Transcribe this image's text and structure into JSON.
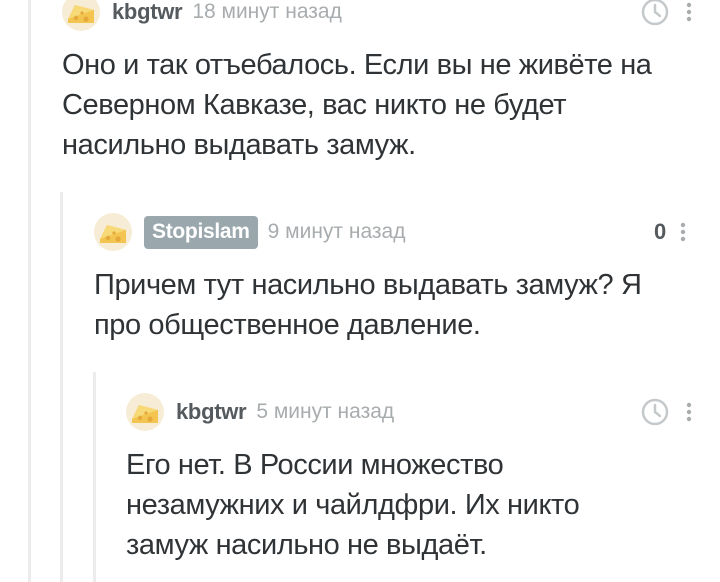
{
  "comments": [
    {
      "username": "kbgtwr",
      "timestamp": "18 минут назад",
      "lines": [
        "Оно и так отъебалось. Если вы не живёте на",
        "Северном Кавказе, вас никто не будет",
        "насильно выдавать замуж."
      ]
    },
    {
      "username": "Stopislam",
      "timestamp": "9 минут назад",
      "rating": "0",
      "lines": [
        "Причем тут насильно выдавать замуж? Я",
        "про общественное давление."
      ]
    },
    {
      "username": "kbgtwr",
      "timestamp": "5 минут назад",
      "lines": [
        "Его нет. В России множество",
        "незамужних и чайлдфри. Их никто",
        "замуж насильно не выдаёт."
      ]
    }
  ],
  "colors": {
    "text": "#2f3336",
    "username": "#555a5e",
    "timestamp": "#a8acae",
    "badge": "#9aa8ae",
    "thread_line": "#ececec",
    "icon": "#c5c9cb"
  },
  "icons": {
    "avatar": "cheese-avatar-icon",
    "save": "clock-icon",
    "menu": "more-vertical-icon"
  }
}
